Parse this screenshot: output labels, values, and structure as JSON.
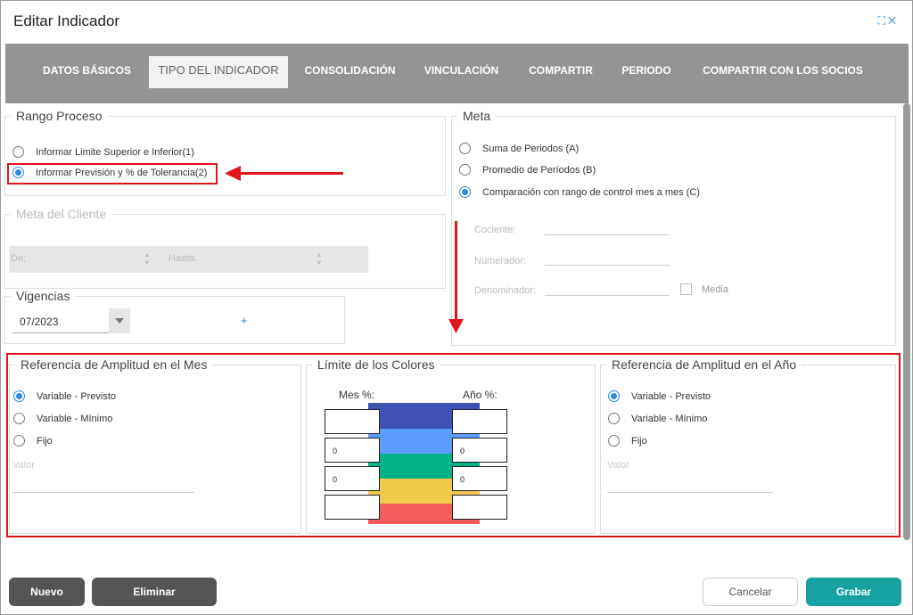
{
  "window": {
    "title": "Editar Indicador",
    "icons": [
      "expand-icon",
      "close-icon"
    ]
  },
  "tabs": [
    {
      "label": "DATOS BÁSICOS",
      "active": false
    },
    {
      "label": "TIPO DEL INDICADOR",
      "active": true
    },
    {
      "label": "CONSOLIDACIÓN",
      "active": false
    },
    {
      "label": "VINCULACIÓN",
      "active": false
    },
    {
      "label": "COMPARTIR",
      "active": false
    },
    {
      "label": "PERIODO",
      "active": false
    },
    {
      "label": "COMPARTIR CON LOS SOCIOS",
      "active": false
    }
  ],
  "rango_proceso": {
    "legend": "Rango Proceso",
    "options": [
      {
        "label": "Informar Limite Superior e Inferior(1)",
        "selected": false
      },
      {
        "label": "Informar Previsión y % de Tolerancia(2)",
        "selected": true
      }
    ]
  },
  "meta_cliente": {
    "legend": "Meta del Cliente",
    "de_label": "De:",
    "hasta_label": "Hasta:"
  },
  "vigencias": {
    "legend": "Vigencias",
    "value": "07/2023",
    "add_label": "+"
  },
  "meta": {
    "legend": "Meta",
    "options": [
      {
        "label": "Suma de Periodos (A)",
        "selected": false
      },
      {
        "label": "Promedio de Períodos (B)",
        "selected": false
      },
      {
        "label": "Comparación con rango de control mes a mes (C)",
        "selected": true
      }
    ],
    "cociente_label": "Cociente:",
    "numerador_label": "Numerador:",
    "denominador_label": "Denominador:",
    "media_label": "Media"
  },
  "ref_mes": {
    "legend": "Referencia de Amplitud en el Mes",
    "options": [
      {
        "label": "Variable - Previsto",
        "selected": true
      },
      {
        "label": "Variable - Mínimo",
        "selected": false
      },
      {
        "label": "Fijo",
        "selected": false
      }
    ],
    "valor_label": "Valor"
  },
  "limite_colores": {
    "legend": "Límite de los Colores",
    "mes_label": "Mes %:",
    "anio_label": "Año %:",
    "mes_values": [
      "",
      "0",
      "0",
      ""
    ],
    "anio_values": [
      "",
      "0",
      "0",
      ""
    ],
    "colors": [
      "#3f51b5",
      "#5c9dff",
      "#00b386",
      "#f2c94c",
      "#f25c5c"
    ]
  },
  "ref_anio": {
    "legend": "Referencia de Amplitud en el Año",
    "options": [
      {
        "label": "Variable - Previsto",
        "selected": true
      },
      {
        "label": "Variable - Mínimo",
        "selected": false
      },
      {
        "label": "Fijo",
        "selected": false
      }
    ],
    "valor_label": "Valor"
  },
  "footer": {
    "nuevo": "Nuevo",
    "eliminar": "Eliminar",
    "cancelar": "Cancelar",
    "grabar": "Grabar"
  },
  "colors": {
    "accent": "#2b8ae0",
    "annotation_red": "#e0141c",
    "tabbar": "#949494",
    "save": "#17a2a0"
  }
}
